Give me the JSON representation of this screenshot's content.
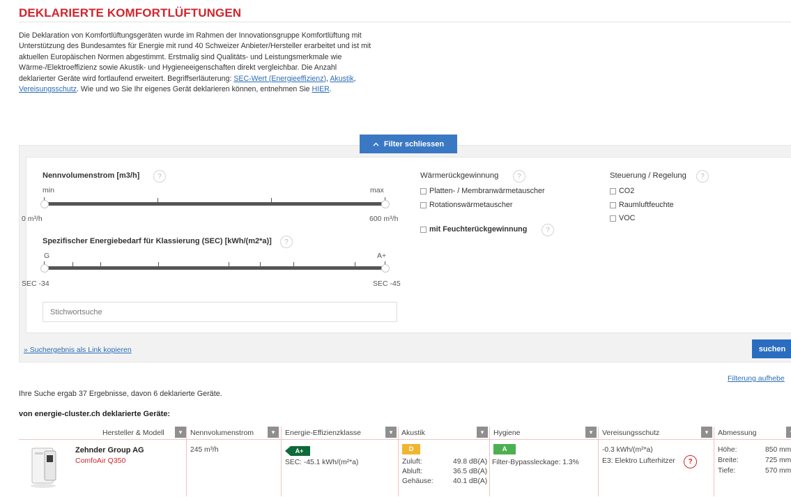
{
  "page": {
    "title": "DEKLARIERTE KOMFORTLÜFTUNGEN",
    "intro": {
      "text_before": "Die Deklaration von Komfortlüftungsgeräten wurde im Rahmen der Innovationsgruppe Komfortlüftung mit Unterstützung des Bundesamtes für Energie mit rund 40 Schweizer Anbieter/Hersteller erarbeitet und ist mit aktuellen Europäischen Normen abgestimmt. Erstmalig sind Qualitäts- und Leistungsmerkmale wie Wärme-/Elektroeffizienz sowie Akustik- und Hygieneeigenschaften direkt vergleichbar. Die Anzahl deklarierter Geräte wird fortlaufend erweitert. Begriffserläuterung: ",
      "link_sec": "SEC-Wert (Energieeffizienz)",
      "sep1": ", ",
      "link_akustik": "Akustik",
      "sep2": ", ",
      "link_vereisung": "Vereisungsschutz",
      "text_after": ". Wie und wo Sie Ihr eigenes Gerät deklarieren können, entnehmen Sie ",
      "link_hier": "HIER",
      "end": "."
    }
  },
  "filter": {
    "toggle_label": "Filter schliessen",
    "toggle_icon": "chevron-up-icon",
    "volume": {
      "label": "Nennvolumenstrom [m3/h]",
      "min_label": "min",
      "max_label": "max",
      "min_value": "0 m³/h",
      "max_value": "600 m³/h"
    },
    "sec": {
      "label": "Spezifischer Energiebedarf für Klassierung (SEC) [kWh/(m2*a)]",
      "left_label": "G",
      "right_label": "A+",
      "min_value": "SEC -34",
      "max_value": "SEC -45"
    },
    "search_placeholder": "Stichwortsuche",
    "heat_recovery": {
      "label": "Wärmerückgewinnung",
      "options": [
        "Platten- / Membranwärmetauscher",
        "Rotationswärmetauscher"
      ],
      "moisture": "mit Feuchterückgewinnung"
    },
    "control": {
      "label": "Steuerung / Regelung",
      "options": [
        "CO2",
        "Raumluftfeuchte",
        "VOC"
      ]
    },
    "help_symbol": "?",
    "copy_link": "» Suchergebnis als Link kopieren",
    "search_button": "suchen",
    "reset_link": "Filterung aufhebe"
  },
  "results": {
    "summary": "Ihre Suche ergab 37 Ergebnisse, davon 6 deklarierte Geräte.",
    "declared_title": "von energie-cluster.ch deklarierte Geräte:",
    "columns": [
      "Hersteller & Modell",
      "Nennvolumenstrom",
      "Energie-Effizienzklasse",
      "Akustik",
      "Hygiene",
      "Vereisungsschutz",
      "Abmessung"
    ],
    "sort_icon": "▾",
    "row": {
      "brand": "Zehnder Group AG",
      "model": "ComfoAir Q350",
      "volume": "245 m³/h",
      "energy_class": "A+",
      "sec": "SEC: -45.1 kWh/(m²*a)",
      "acoustic_class": "D",
      "acoustic": [
        {
          "label": "Zuluft:",
          "value": "49.8 dB(A)"
        },
        {
          "label": "Abluft:",
          "value": "36.5 dB(A)"
        },
        {
          "label": "Gehäuse:",
          "value": "40.1 dB(A)"
        }
      ],
      "hygiene_class": "A",
      "hygiene_text": "Filter-Bypassleckage: 1.3%",
      "frost_value": "-0.3 kWh/(m²*a)",
      "frost_text": "E3: Elektro Lufterhitzer",
      "dimensions": [
        {
          "label": "Höhe:",
          "value": "850 mm"
        },
        {
          "label": "Breite:",
          "value": "725 mm"
        },
        {
          "label": "Tiefe:",
          "value": "570 mm"
        }
      ]
    }
  },
  "colors": {
    "accent_red": "#d0252d",
    "primary_blue": "#3a78c4",
    "class_aplus": "#0d6a3a",
    "class_d": "#f1b52f",
    "class_a": "#4cb050"
  }
}
